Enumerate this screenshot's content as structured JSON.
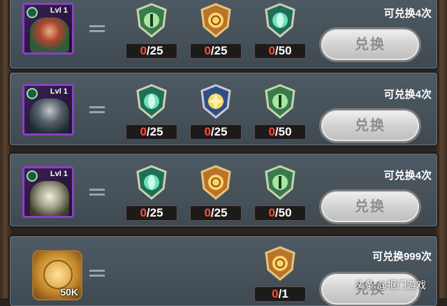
{
  "rows": [
    {
      "level": "Lvl 1",
      "portrait": "hero-witch-portrait",
      "costs": [
        {
          "emblem": "green-eye-emblem",
          "have": "0",
          "need": "/25"
        },
        {
          "emblem": "gold-emblem",
          "have": "0",
          "need": "/25"
        },
        {
          "emblem": "green-leaf-emblem",
          "have": "0",
          "need": "/50"
        }
      ],
      "remaining": "可兑换4次",
      "button": "兑换"
    },
    {
      "level": "Lvl 1",
      "portrait": "hero-hooded-portrait",
      "costs": [
        {
          "emblem": "green-leaf-emblem",
          "have": "0",
          "need": "/25"
        },
        {
          "emblem": "blue-star-emblem",
          "have": "0",
          "need": "/25"
        },
        {
          "emblem": "green-eye-emblem",
          "have": "0",
          "need": "/50"
        }
      ],
      "remaining": "可兑换4次",
      "button": "兑换"
    },
    {
      "level": "Lvl 1",
      "portrait": "hero-armored-portrait",
      "costs": [
        {
          "emblem": "green-leaf-emblem",
          "have": "0",
          "need": "/25"
        },
        {
          "emblem": "gold-emblem",
          "have": "0",
          "need": "/25"
        },
        {
          "emblem": "green-eye-emblem",
          "have": "0",
          "need": "/50"
        }
      ],
      "remaining": "可兑换4次",
      "button": "兑换"
    }
  ],
  "gold_row": {
    "amount": "50K",
    "cost": {
      "emblem": "gold-emblem",
      "have": "0",
      "need": "/1"
    },
    "remaining": "可兑换999次",
    "button": "兑换"
  },
  "watermark": "头条 @抠门游戏",
  "colors": {
    "count_have": "#ff4b3e",
    "button_text": "#8d8d8d",
    "portrait_border": "#8d3fc6"
  }
}
